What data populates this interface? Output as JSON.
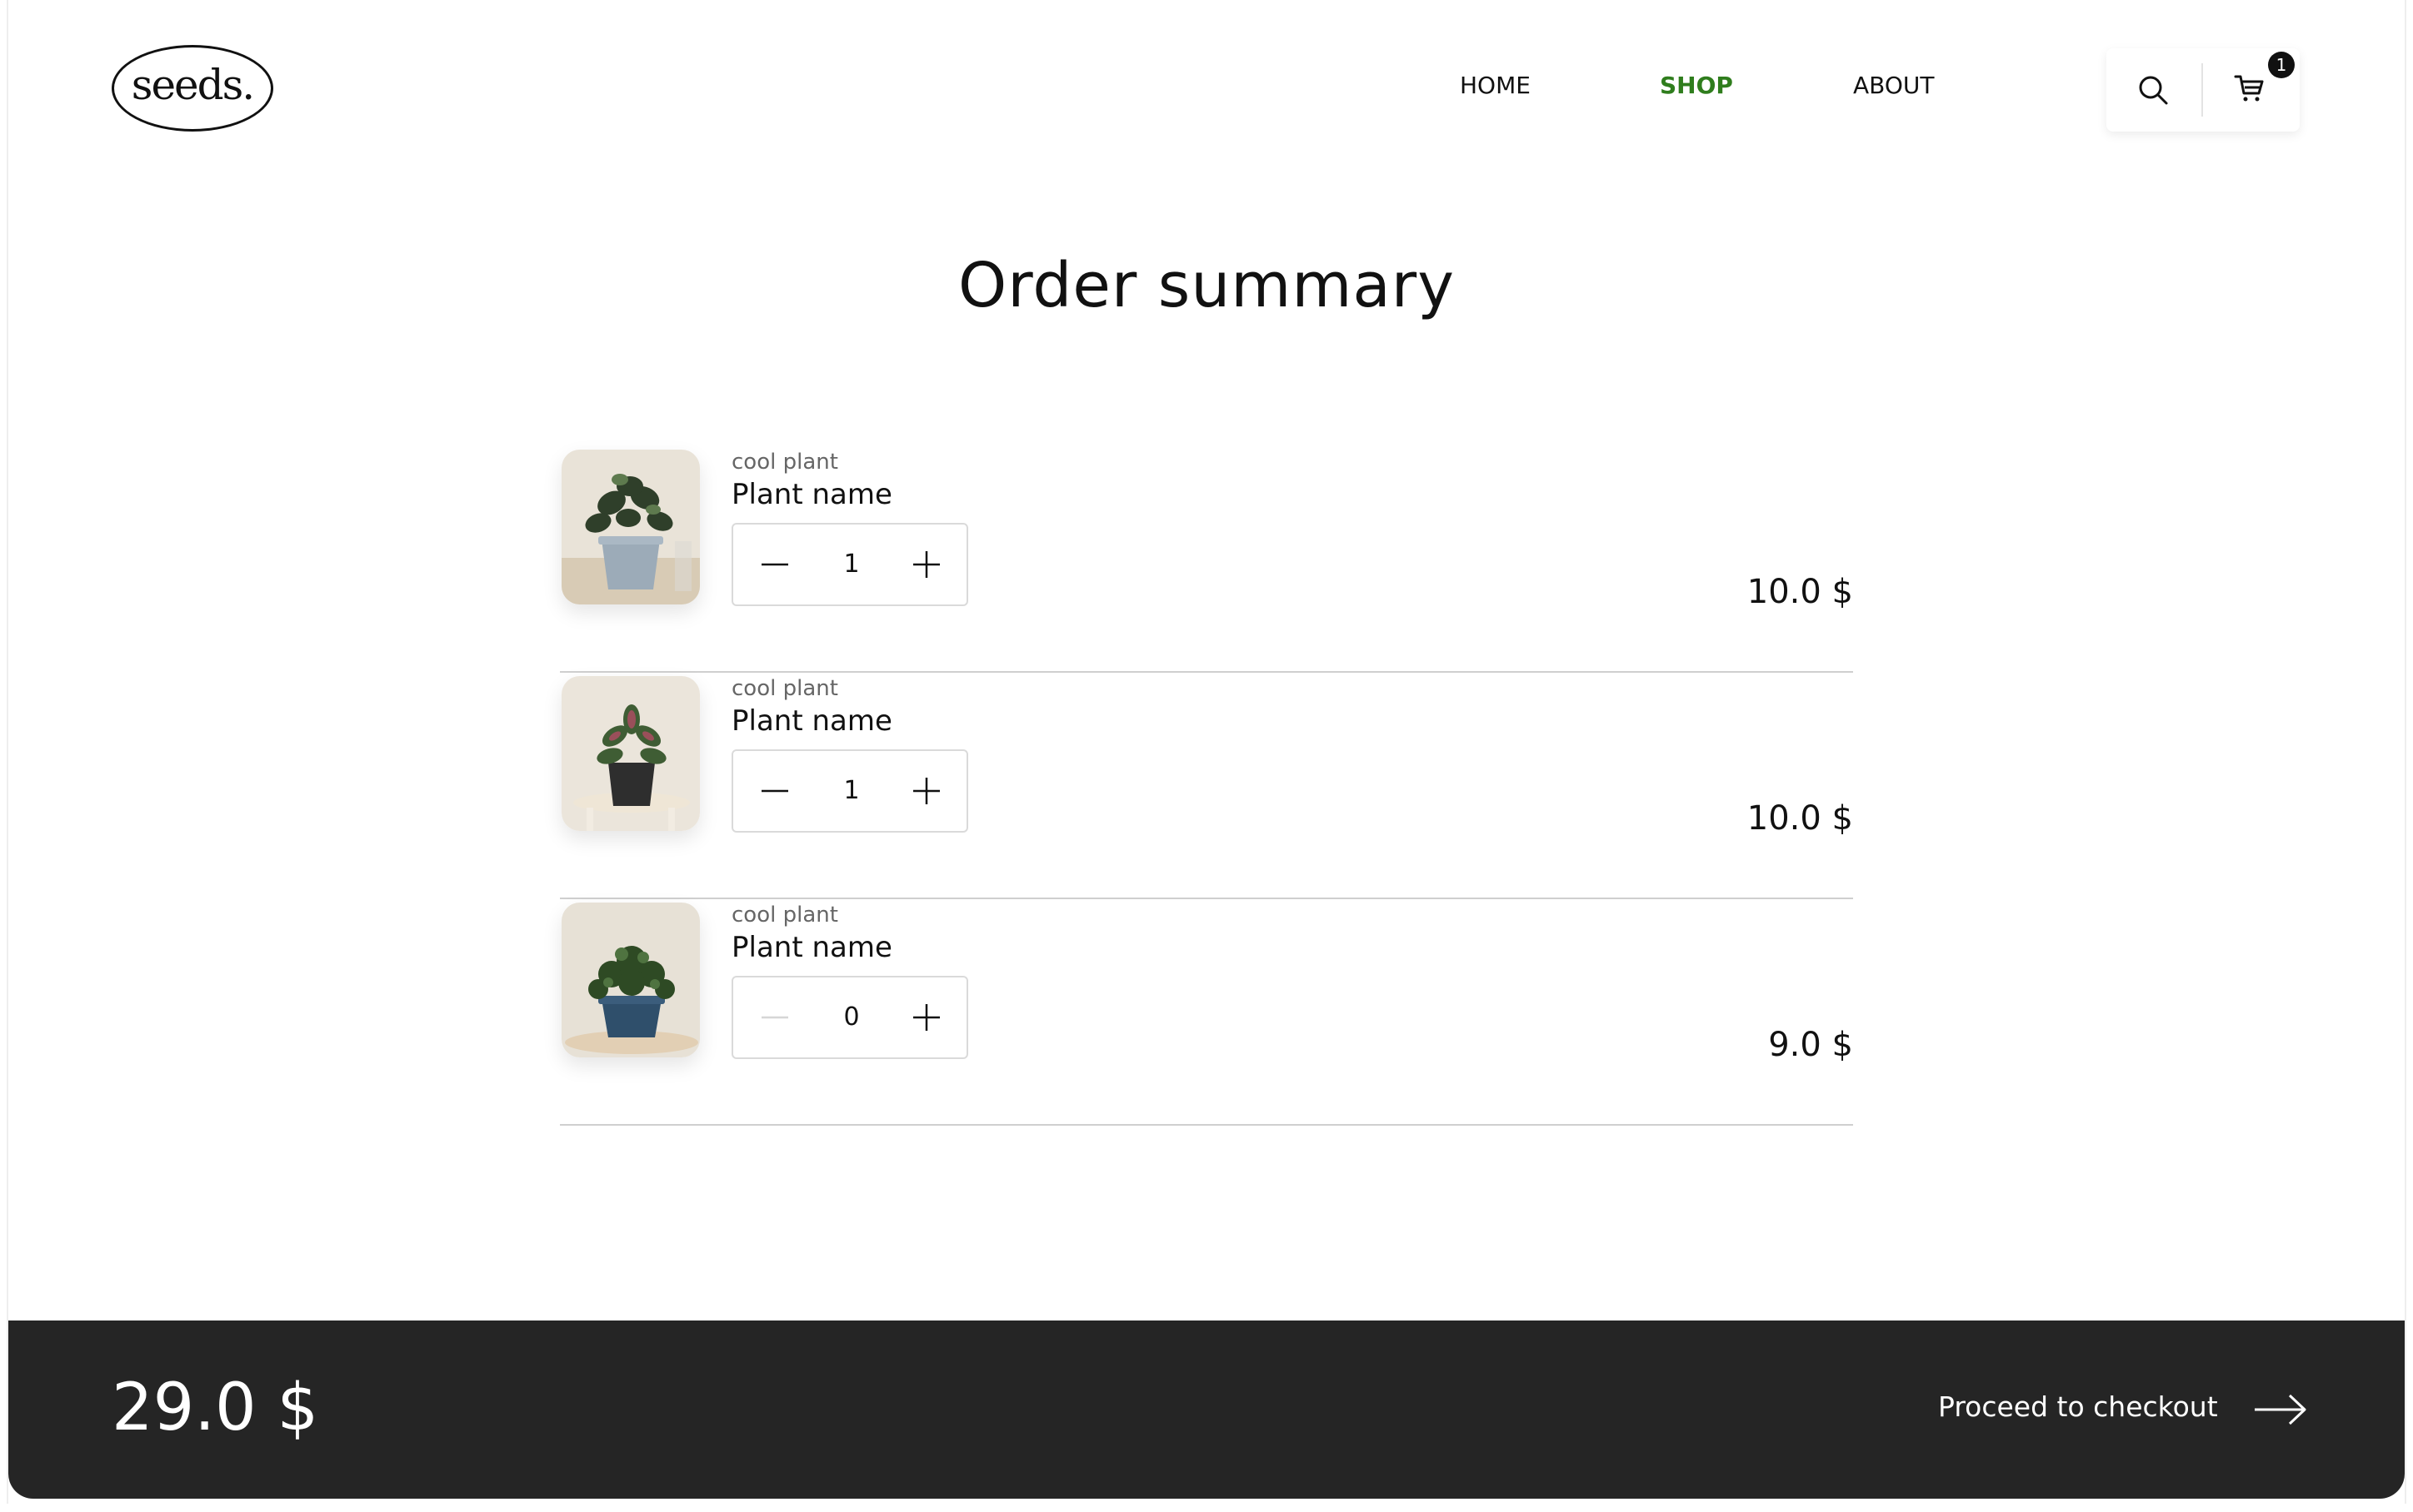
{
  "header": {
    "logo_text": "seeds.",
    "nav": [
      {
        "label": "HOME",
        "active": false
      },
      {
        "label": "SHOP",
        "active": true
      },
      {
        "label": "ABOUT",
        "active": false
      }
    ],
    "cart_count": "1",
    "icons": [
      "search-icon",
      "cart-icon"
    ]
  },
  "main": {
    "title": "Order summary",
    "items": [
      {
        "subtitle": "cool plant",
        "name": "Plant name",
        "qty": "1",
        "price": "10.0 $"
      },
      {
        "subtitle": "cool plant",
        "name": "Plant name",
        "qty": "1",
        "price": "10.0 $"
      },
      {
        "subtitle": "cool plant",
        "name": "Plant name",
        "qty": "0",
        "price": "9.0 $"
      }
    ]
  },
  "footer": {
    "total": "29.0 $",
    "checkout_label": "Proceed to checkout"
  },
  "colors": {
    "accent": "#2f7d1d",
    "footer_bg": "#252525",
    "divider": "#cfcfcf"
  }
}
